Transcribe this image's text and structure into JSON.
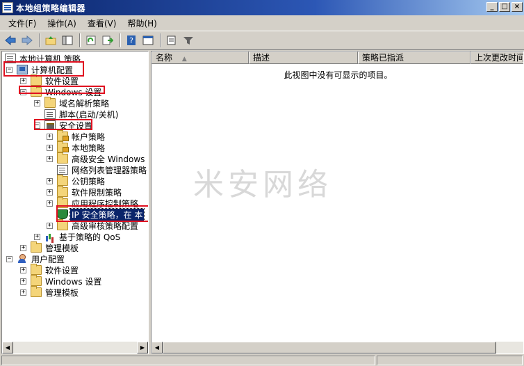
{
  "window": {
    "title": "本地组策略编辑器"
  },
  "window_buttons": [
    "_",
    "□",
    "×"
  ],
  "menu": [
    {
      "label": "文件(F)"
    },
    {
      "label": "操作(A)"
    },
    {
      "label": "查看(V)"
    },
    {
      "label": "帮助(H)"
    }
  ],
  "toolbar": {
    "buttons": [
      "back-arrow-icon",
      "forward-arrow-icon",
      "up-folder-icon",
      "show-hide-tree-icon",
      "refresh-icon",
      "export-list-icon",
      "help-icon",
      "properties-icon",
      "notepad-icon",
      "filter-icon"
    ]
  },
  "tree": {
    "root": "本地计算机 策略",
    "computer_config": "计算机配置",
    "software_settings": "软件设置",
    "windows_settings": "Windows 设置",
    "name_resolution": "域名解析策略",
    "scripts": "脚本(启动/关机)",
    "security_settings": "安全设置",
    "account_policies": "帐户策略",
    "local_policies": "本地策略",
    "advanced_firewall": "高级安全 Windows 防",
    "network_list": "网络列表管理器策略",
    "public_key": "公钥策略",
    "software_restriction": "软件限制策略",
    "app_control": "应用程序控制策略",
    "ip_security": "IP 安全策略，在 本",
    "advanced_audit": "高级审核策略配置",
    "qos": "基于策略的 QoS",
    "admin_templates": "管理模板",
    "user_config": "用户配置",
    "user_software_settings": "软件设置",
    "user_windows_settings": "Windows 设置",
    "user_admin_templates": "管理模板"
  },
  "list": {
    "columns": [
      "名称",
      "描述",
      "策略已指派",
      "上次更改时间"
    ],
    "empty_message": "此视图中没有可显示的项目。"
  },
  "watermark": "米安网络",
  "colors": {
    "selection": "#0a246a",
    "highlight_box": "#e01020",
    "title_bar": "#0a246a"
  }
}
